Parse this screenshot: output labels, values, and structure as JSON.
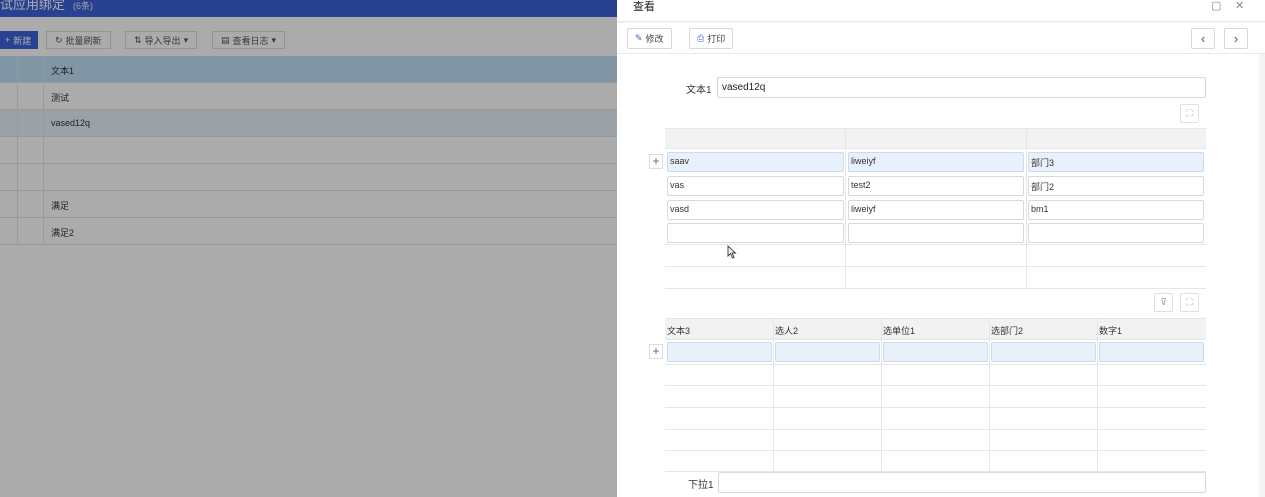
{
  "background": {
    "title": "试应用绑定",
    "title_suffix": "(6条)",
    "toolbar": {
      "new_label": "新建",
      "refresh_label": "批量刷新",
      "import_export_label": "导入导出",
      "log_label": "查看日志"
    },
    "table": {
      "header": "文本1",
      "rows": [
        "测试",
        "vased12q",
        "",
        "",
        "满足",
        "满足2"
      ]
    }
  },
  "panel": {
    "title": "查看",
    "toolbar": {
      "edit_label": "修改",
      "print_label": "打印"
    },
    "form": {
      "text1_label": "文本1",
      "text1_value": "vased12q",
      "dropdown_label": "下拉1",
      "dropdown_value": ""
    },
    "subtable1": {
      "headers": [
        "",
        "",
        ""
      ],
      "rows": [
        [
          "saav",
          "liweiyf",
          "部门3"
        ],
        [
          "vas",
          "test2",
          "部门2"
        ],
        [
          "vasd",
          "liweiyf",
          "bm1"
        ],
        [
          "",
          "",
          ""
        ]
      ]
    },
    "subtable2": {
      "headers": [
        "文本3",
        "选人2",
        "选单位1",
        "选部门2",
        "数字1"
      ],
      "rows": [
        [
          "",
          "",
          "",
          "",
          ""
        ]
      ]
    }
  }
}
